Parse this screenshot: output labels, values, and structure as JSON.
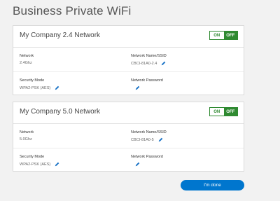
{
  "page": {
    "title": "Business Private WiFi"
  },
  "networks": [
    {
      "title": "My Company 2.4 Network",
      "toggle": {
        "on_label": "ON",
        "off_label": "OFF",
        "state": "off"
      },
      "network_label": "Network",
      "network_value": "2.4Ghz",
      "ssid_label": "Network Name/SSID",
      "ssid_value": "CBCI-81A0-2.4",
      "security_label": "Security Mode",
      "security_value": "WPA2-PSK (AES)",
      "password_label": "Network Password",
      "password_value": ""
    },
    {
      "title": "My Company 5.0 Network",
      "toggle": {
        "on_label": "ON",
        "off_label": "OFF",
        "state": "off"
      },
      "network_label": "Network",
      "network_value": "5.0Ghz",
      "ssid_label": "Network Name/SSID",
      "ssid_value": "CBCI-81A0-5",
      "security_label": "Security Mode",
      "security_value": "WPA2-PSK (AES)",
      "password_label": "Network Password",
      "password_value": ""
    }
  ],
  "done_button": {
    "label": "I'm done"
  },
  "colors": {
    "accent_green": "#2f8a31",
    "button_blue": "#0076ce",
    "pencil_blue": "#1a73c6"
  },
  "icons": {
    "edit": "pencil-icon"
  }
}
